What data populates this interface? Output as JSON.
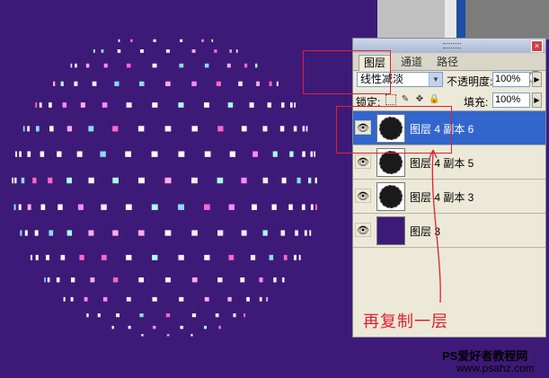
{
  "colors": {
    "canvas_bg": "#3e1a78",
    "annotation": "#e0202c",
    "selection": "#3266cc"
  },
  "panel": {
    "tabs": [
      "图层",
      "通道",
      "路径"
    ],
    "blend_mode": "线性减淡",
    "opacity_label": "不透明度:",
    "opacity_value": "100%",
    "lock_label": "锁定:",
    "lock_icons": [
      "transparency-lock-icon",
      "brush-lock-icon",
      "move-lock-icon",
      "padlock-icon"
    ],
    "fill_label": "填充:",
    "fill_value": "100%",
    "layers": [
      {
        "name": "图层 4 副本 6",
        "selected": true,
        "thumbnail": "black-sphere"
      },
      {
        "name": "图层 4 副本 5",
        "selected": false,
        "thumbnail": "black-sphere"
      },
      {
        "name": "图层 4 副本 3",
        "selected": false,
        "thumbnail": "black-sphere"
      },
      {
        "name": "图层 3",
        "selected": false,
        "thumbnail": "purple-fill"
      }
    ]
  },
  "annotation": "再复制一层",
  "watermark": {
    "line1": "PS爱好者教程网",
    "line2": "www.psahz.com"
  }
}
